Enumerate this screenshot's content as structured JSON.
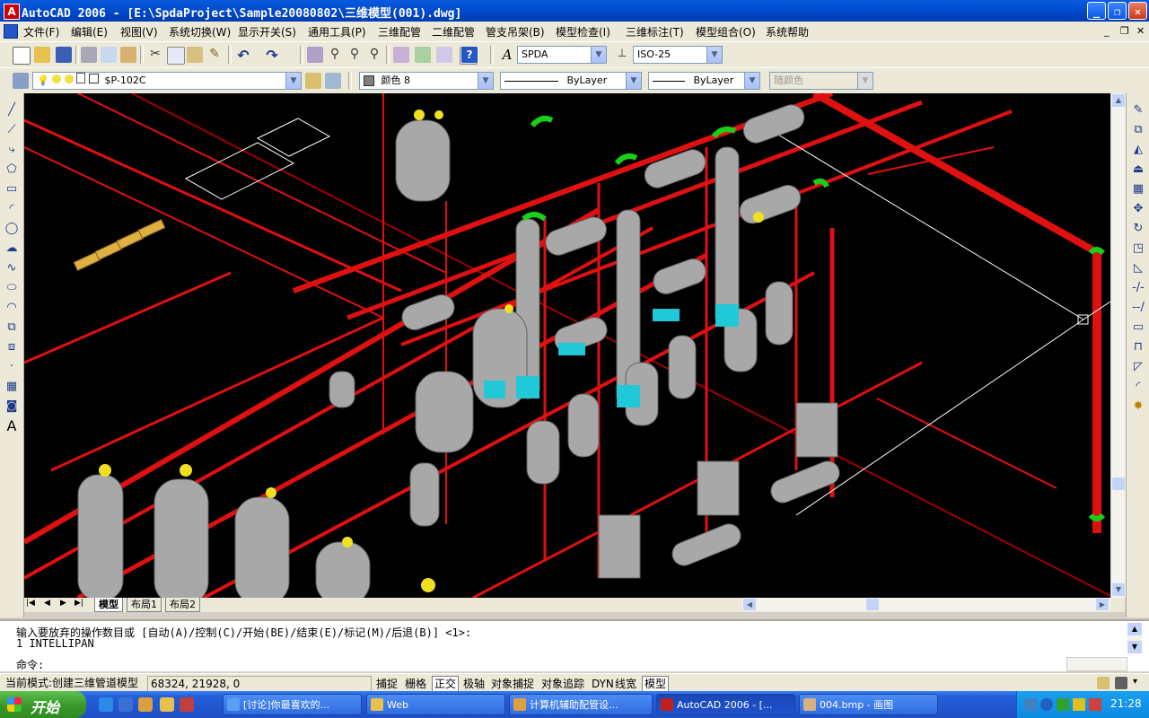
{
  "window": {
    "title": "AutoCAD 2006 - [E:\\SpdaProject\\Sample20080802\\三维模型(001).dwg]"
  },
  "menu": [
    "文件(F)",
    "编辑(E)",
    "视图(V)",
    "系统切换(W)",
    "显示开关(S)",
    "通用工具(P)",
    "三维配管",
    "二维配管",
    "管支吊架(B)",
    "模型检查(I)",
    "三维标注(T)",
    "模型组合(O)",
    "系统帮助"
  ],
  "toolbar": {
    "text_style": "SPDA",
    "dim_style": "ISO-25",
    "layer": "$P-102C",
    "color": "颜色 8",
    "linetype": "ByLayer",
    "lineweight": "ByLayer",
    "plot_style": "随颜色"
  },
  "layout_tabs": [
    "模型",
    "布局1",
    "布局2"
  ],
  "command": {
    "prompt": "输入要放弃的操作数目或 [自动(A)/控制(C)/开始(BE)/结束(E)/标记(M)/后退(B)] <1>:",
    "history": "1 INTELLIPAN",
    "input_label": "命令:"
  },
  "status": {
    "mode": "当前模式:创建三维管道模型",
    "coords": "68324, 21928, 0",
    "buttons": [
      "捕捉",
      "栅格",
      "正交",
      "极轴",
      "对象捕捉",
      "对象追踪",
      "DYN",
      "线宽",
      "模型"
    ],
    "active": [
      "正交",
      "模型"
    ]
  },
  "taskbar": {
    "start": "开始",
    "tasks": [
      "[讨论]你最喜欢的...",
      "Web",
      "计算机辅助配管设...",
      "AutoCAD 2006 - [...",
      "004.bmp - 画图"
    ],
    "clock": "21:28"
  }
}
